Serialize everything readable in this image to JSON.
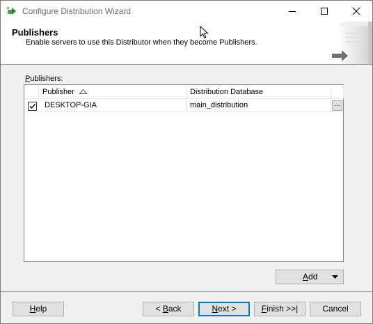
{
  "window": {
    "title": "Configure Distribution Wizard"
  },
  "header": {
    "title": "Publishers",
    "subtitle": "Enable servers to use this Distributor when they become Publishers."
  },
  "publishers_section": {
    "label_first": "P",
    "label_rest": "ublishers:"
  },
  "grid": {
    "columns": [
      "Publisher",
      "Distribution Database"
    ],
    "rows": [
      {
        "checked": true,
        "publisher": "DESKTOP-GIA",
        "distribution_database": "main_distribution",
        "browse_label": "..."
      }
    ]
  },
  "add_button": {
    "first": "A",
    "rest": "dd"
  },
  "footer": {
    "help": {
      "first": "H",
      "rest": "elp"
    },
    "back": {
      "prefix": "< ",
      "first": "B",
      "rest": "ack"
    },
    "next": {
      "first": "N",
      "rest": "ext >"
    },
    "finish": {
      "first": "F",
      "rest": "inish >>|"
    },
    "cancel": "Cancel"
  }
}
